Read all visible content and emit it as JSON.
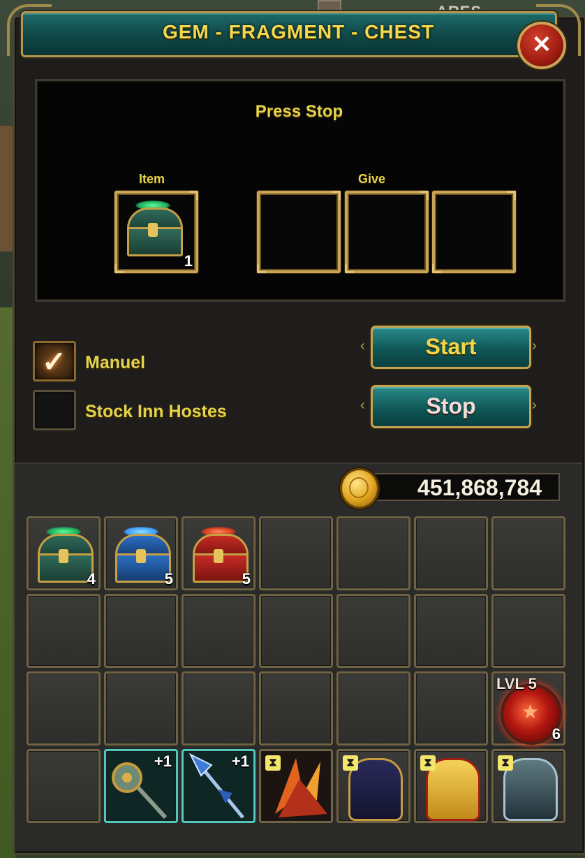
{
  "window": {
    "title": "GEM - FRAGMENT - CHEST",
    "close_label": "✕"
  },
  "background": {
    "text": "ARES"
  },
  "panel": {
    "status": "Press Stop",
    "item_label": "Item",
    "give_label": "Give",
    "item_slot": {
      "icon": "green-gem-chest-icon",
      "count": "1"
    },
    "give_slots": [
      {},
      {},
      {}
    ]
  },
  "options": [
    {
      "label": "Manuel",
      "checked": true
    },
    {
      "label": "Stock Inn Hostes",
      "checked": false
    }
  ],
  "buttons": {
    "start": "Start",
    "stop": "Stop"
  },
  "gold": {
    "amount": "451,868,784"
  },
  "inventory": {
    "rows": [
      [
        {
          "icon": "green-chest-icon",
          "count": "4"
        },
        {
          "icon": "blue-chest-icon",
          "count": "5"
        },
        {
          "icon": "red-chest-icon",
          "count": "5"
        },
        {},
        {},
        {},
        {}
      ],
      [
        {},
        {},
        {},
        {},
        {},
        {},
        {}
      ],
      [
        {},
        {},
        {},
        {},
        {},
        {},
        {
          "icon": "red-orb-icon",
          "level": "LVL 5",
          "count": "6"
        }
      ],
      [
        {},
        {
          "icon": "mace-icon",
          "plus": "+1"
        },
        {
          "icon": "spear-icon",
          "plus": "+1"
        },
        {
          "icon": "flame-wings-icon",
          "timed": true
        },
        {
          "icon": "dark-armor-icon",
          "timed": true
        },
        {
          "icon": "gold-armor-icon",
          "timed": true
        },
        {
          "icon": "silver-armor-icon",
          "timed": true
        }
      ]
    ]
  },
  "colors": {
    "accent_gold": "#e6d34a",
    "teal": "#0f5757",
    "frame_gold": "#c9a559"
  }
}
